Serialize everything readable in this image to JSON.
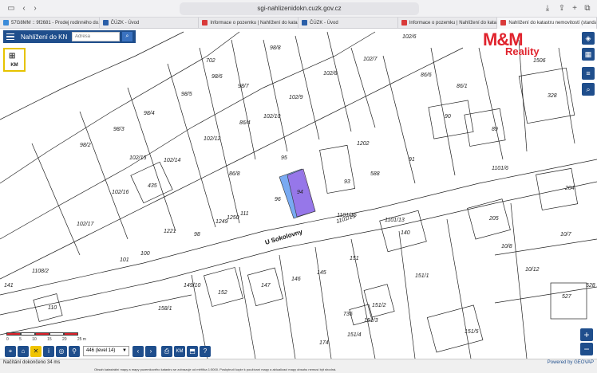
{
  "browser": {
    "url": "sgi-nahlizenidokn.cuzk.gov.cz",
    "tabs": [
      {
        "label": "57G8MM :: 9f2681 - Prodej rodinného do...",
        "color": "#3b8bd9"
      },
      {
        "label": "ČÚZK - Úvod",
        "color": "#2b5fa8"
      },
      {
        "label": "Informace o pozemku | Nahlížení do katast...",
        "color": "#d93a3a"
      },
      {
        "label": "ČÚZK - Úvod",
        "color": "#2b5fa8"
      },
      {
        "label": "Informace o pozemku | Nahlížení do katast...",
        "color": "#d93a3a"
      },
      {
        "label": "Nahlížení do katastru nemovitostí (standard)",
        "color": "#d93a3a"
      }
    ]
  },
  "app": {
    "title": "Nahlížení do KN",
    "address_placeholder": "Adresa",
    "km_label": "KM"
  },
  "logo": {
    "main": "M&M",
    "sub": "Reality",
    "color": "#e0232d"
  },
  "map": {
    "street_label_1": "U Sokolovny",
    "street_label_2": "1101/15",
    "parcel_labels": [
      "702",
      "98/8",
      "102/6",
      "102/7",
      "1506",
      "98/6",
      "98/7",
      "102/8",
      "86/6",
      "86/1",
      "98/5",
      "102/9",
      "328",
      "98/4",
      "86/4",
      "102/10",
      "90",
      "89",
      "98/3",
      "102/12",
      "1202",
      "98/2",
      "102/15",
      "102/14",
      "435",
      "95",
      "91",
      "588",
      "1101/6",
      "102/16",
      "86/8",
      "94",
      "93",
      "204",
      "102/17",
      "111",
      "96",
      "1101/15",
      "1101/13",
      "205",
      "1221",
      "98",
      "1250",
      "1249",
      "140",
      "10/7",
      "101",
      "100",
      "151",
      "10/8",
      "1108/2",
      "149/10",
      "147",
      "146",
      "145",
      "151/1",
      "10/12",
      "141",
      "152",
      "158/1",
      "151/2",
      "528",
      "527",
      "110",
      "736",
      "151/3",
      "151/4",
      "174",
      "151/5"
    ],
    "highlight_parcel": "94",
    "highlight_color": "#9b6ee8"
  },
  "toolbar": {
    "zoom_level": "446 (level 14)",
    "scale_numbers": [
      "0",
      "5",
      "10",
      "15",
      "20",
      "25 m"
    ],
    "scale_colors": [
      "#e0232d",
      "#ffffff",
      "#e0232d",
      "#ffffff",
      "#e0232d"
    ]
  },
  "status": {
    "left": "Načítání dokončeno 34 ms",
    "right": "Powered by GEOVAP",
    "fine": "Obsah katastrální mapy a mapy pozemkového katastru se zobrazuje od měřítka 1:5000. Poskytnutí kopie k používaní mapy a aktualizaci mapy obsahu nemusí být shodná."
  }
}
